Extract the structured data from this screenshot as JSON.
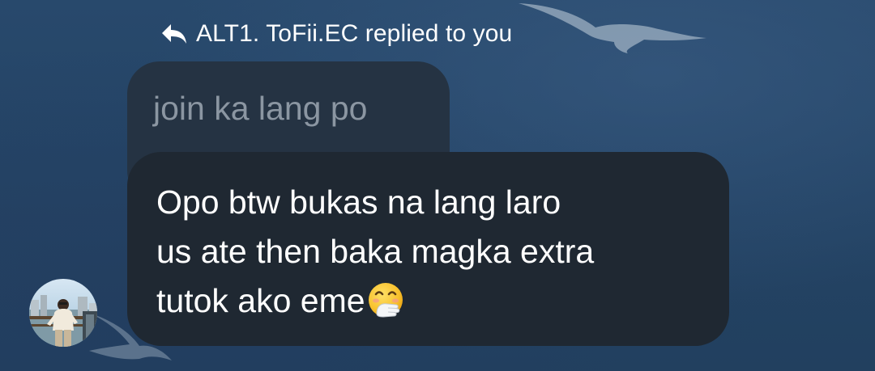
{
  "reply_header": {
    "text": "ALT1. ToFii.EC replied to you",
    "icon": "reply-arrow-icon"
  },
  "quoted_message": {
    "text": "join ka lang po"
  },
  "message": {
    "text": "Opo btw bukas na lang laro\nus ate then baka magka extra\ntutok ako eme",
    "emoji": "face-with-hand-over-mouth-emoji"
  },
  "avatar": {
    "icon": "user-avatar"
  },
  "colors": {
    "background": "#244466",
    "quoted_bubble": "#253343",
    "message_bubble": "#1f2832",
    "quoted_text": "#8b96a2",
    "message_text": "#ffffff"
  }
}
